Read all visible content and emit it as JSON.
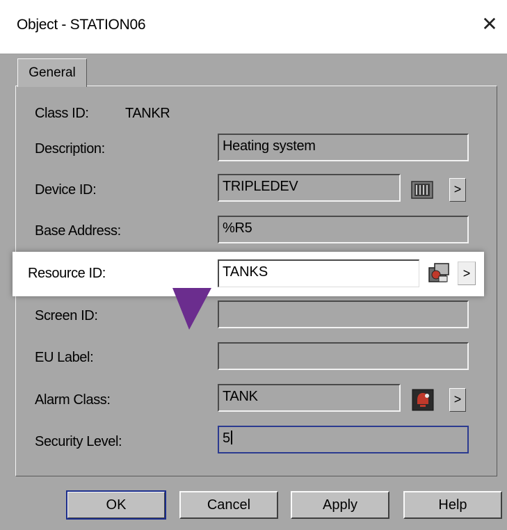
{
  "window": {
    "title": "Object - STATION06",
    "close_glyph": "✕"
  },
  "tabs": [
    {
      "label": "General"
    }
  ],
  "form": {
    "class_id_label": "Class ID:",
    "class_id_value": "TANKR",
    "description": {
      "label": "Description:",
      "value": "Heating system"
    },
    "device_id": {
      "label": "Device ID:",
      "value": "TRIPLEDEV",
      "icon": "device-icon",
      "browse": ">"
    },
    "base_address": {
      "label": "Base Address:",
      "value": "%R5"
    },
    "resource_id": {
      "label": "Resource ID:",
      "value": "TANKS",
      "icon": "resource-icon",
      "browse": ">"
    },
    "screen_id": {
      "label": "Screen ID:",
      "value": ""
    },
    "eu_label": {
      "label": "EU Label:",
      "value": ""
    },
    "alarm_class": {
      "label": "Alarm Class:",
      "value": "TANK",
      "icon": "alarm-icon",
      "browse": ">"
    },
    "security_level": {
      "label": "Security Level:",
      "value": "5"
    }
  },
  "buttons": {
    "ok": "OK",
    "cancel": "Cancel",
    "apply": "Apply",
    "help": "Help"
  },
  "colors": {
    "dialog_bg": "#a7a7a7",
    "highlight_bg": "#ffffff",
    "pointer": "#6b2d8e",
    "focus_border": "#1b2d8c"
  }
}
